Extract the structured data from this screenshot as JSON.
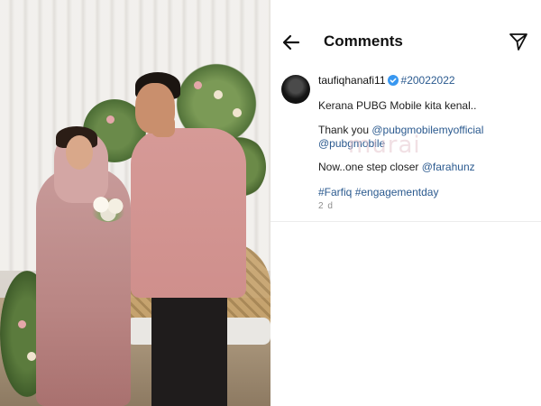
{
  "header": {
    "title": "Comments",
    "back_icon": "arrow-left-icon",
    "send_icon": "paper-plane-icon"
  },
  "comment": {
    "username": "taufiqhanafi11",
    "verified_icon": "verified-badge-icon",
    "hashtag_top": "#20022022",
    "line1": "Kerana PUBG Mobile kita kenal..",
    "line2_prefix": "Thank you ",
    "mention1": "@pubgmobilemyofficial",
    "mention2": "@pubgmobile",
    "line3_prefix": "Now..one step closer ",
    "mention3": "@farahunz",
    "tag1": "#Farfiq",
    "tag2": "#engagementday",
    "time": "2 d"
  },
  "watermark": "murai",
  "colors": {
    "link": "#2b5a8f",
    "verified": "#3897f0",
    "divider": "#ececec"
  }
}
